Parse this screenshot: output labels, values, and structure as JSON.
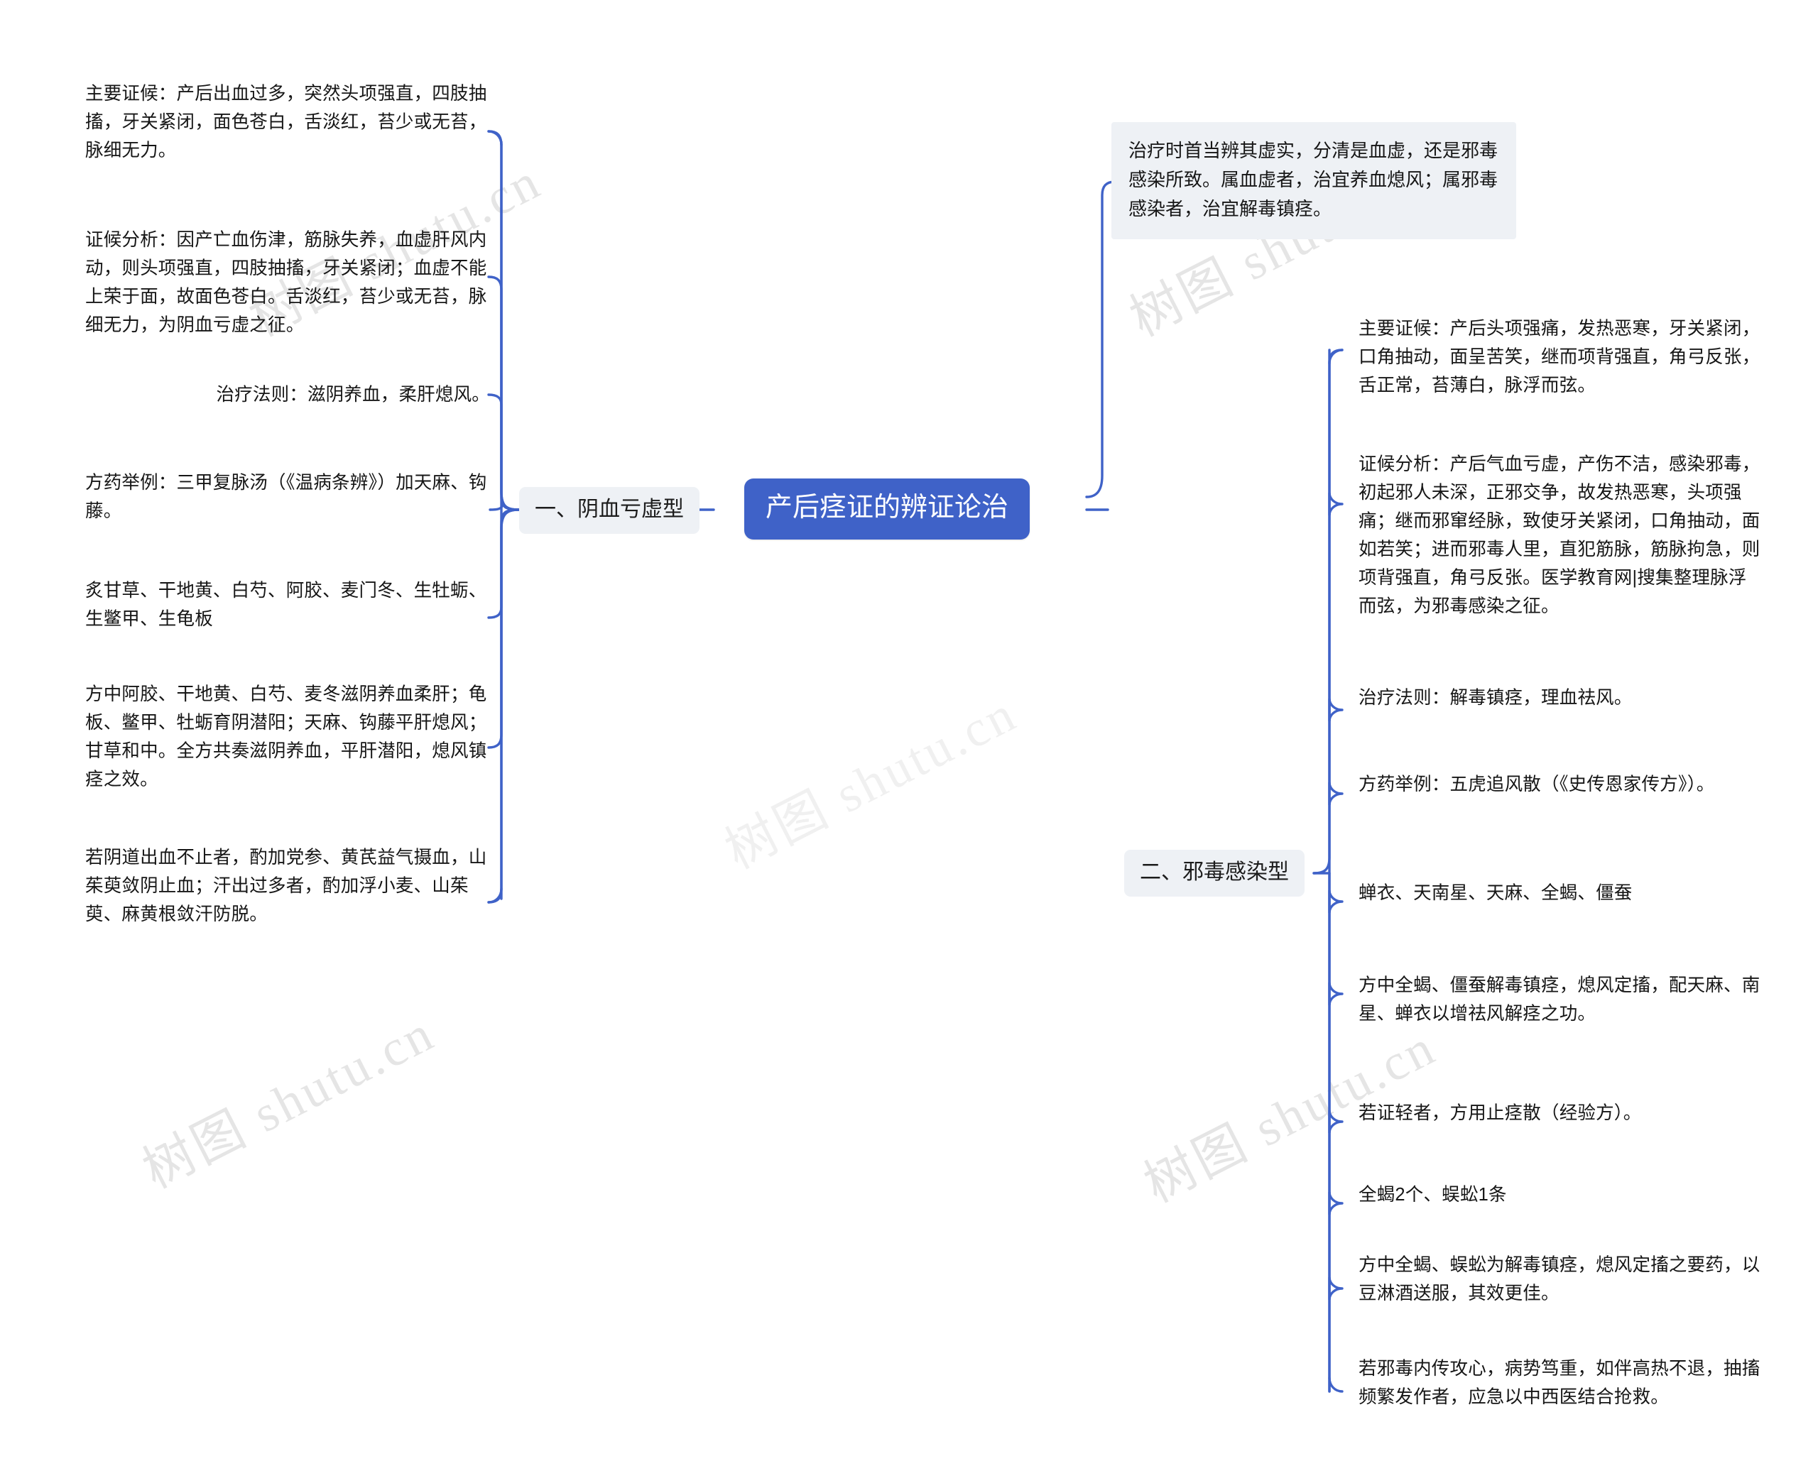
{
  "title": "产后痉证的辨证论治",
  "central_node": {
    "label": "产后痉证的辨证论治",
    "color": "#3f62c8",
    "text_color": "#ffffff"
  },
  "note": {
    "text": "治疗时首当辨其虚实，分清是血虚，还是邪毒感染所致。属血虚者，治宜养血熄风；属邪毒感染者，治宜解毒镇痉。",
    "background": "#eef1f5"
  },
  "branches": [
    {
      "label": "一、阴血亏虚型",
      "side": "left",
      "background": "#eef1f5",
      "items": [
        {
          "text": "主要证候：产后出血过多，突然头项强直，四肢抽搐，牙关紧闭，面色苍白，舌淡红，苔少或无苔，脉细无力。"
        },
        {
          "text": "证候分析：因产亡血伤津，筋脉失养，血虚肝风内动，则头项强直，四肢抽搐，牙关紧闭；血虚不能上荣于面，故面色苍白。舌淡红，苔少或无苔，脉细无力，为阴血亏虚之征。"
        },
        {
          "text": "治疗法则：滋阴养血，柔肝熄风。"
        },
        {
          "text": "方药举例：三甲复脉汤（《温病条辨》）加天麻、钩藤。"
        },
        {
          "text": "炙甘草、干地黄、白芍、阿胶、麦门冬、生牡蛎、生鳖甲、生龟板"
        },
        {
          "text": "方中阿胶、干地黄、白芍、麦冬滋阴养血柔肝；龟板、鳖甲、牡蛎育阴潜阳；天麻、钩藤平肝熄风；甘草和中。全方共奏滋阴养血，平肝潜阳，熄风镇痉之效。"
        },
        {
          "text": "若阴道出血不止者，酌加党参、黄芪益气摄血，山茱萸敛阴止血；汗出过多者，酌加浮小麦、山茱萸、麻黄根敛汗防脱。"
        }
      ]
    },
    {
      "label": "二、邪毒感染型",
      "side": "right",
      "background": "#eef1f5",
      "items": [
        {
          "text": "主要证候：产后头项强痛，发热恶寒，牙关紧闭，口角抽动，面呈苦笑，继而项背强直，角弓反张，舌正常，苔薄白，脉浮而弦。"
        },
        {
          "text": "证候分析：产后气血亏虚，产伤不洁，感染邪毒，初起邪人未深，正邪交争，故发热恶寒，头项强痛；继而邪窜经脉，致使牙关紧闭，口角抽动，面如若笑；进而邪毒人里，直犯筋脉，筋脉拘急，则项背强直，角弓反张。医学教育网|搜集整理脉浮而弦，为邪毒感染之征。"
        },
        {
          "text": "治疗法则：解毒镇痉，理血祛风。"
        },
        {
          "text": "方药举例：五虎追风散（《史传恩家传方》）。"
        },
        {
          "text": "蝉衣、天南星、天麻、全蝎、僵蚕"
        },
        {
          "text": "方中全蝎、僵蚕解毒镇痉，熄风定搐，配天麻、南星、蝉衣以增祛风解痉之功。"
        },
        {
          "text": "若证轻者，方用止痉散（经验方）。"
        },
        {
          "text": "全蝎2个、蜈蚣1条"
        },
        {
          "text": "方中全蝎、蜈蚣为解毒镇痉，熄风定搐之要药，以豆淋酒送服，其效更佳。"
        },
        {
          "text": "若邪毒内传攻心，病势笃重，如伴高热不退，抽搐频繁发作者，应急以中西医结合抢救。"
        }
      ]
    }
  ],
  "watermarks": [
    "树图 shutu.cn",
    "树图 shutu.cn",
    "树图 shutu.cn",
    "树图 shutu.cn",
    "树图 shutu.cn"
  ],
  "colors": {
    "connector": "#3f62c8",
    "node_background": "#eef1f5",
    "central_background": "#3f62c8",
    "text": "#161616"
  }
}
